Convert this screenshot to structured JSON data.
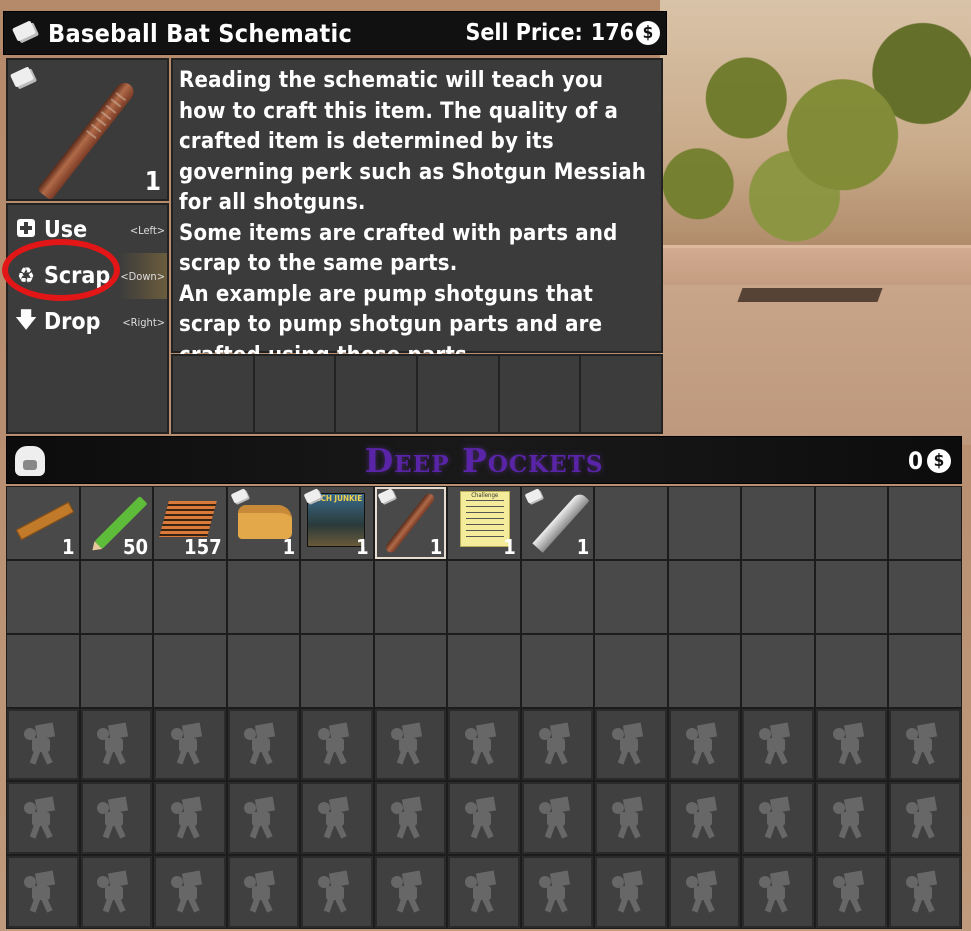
{
  "item": {
    "title": "Baseball Bat Schematic",
    "sell_label": "Sell Price:",
    "sell_value": "176",
    "coin_symbol": "$",
    "count": "1",
    "description_lines": [
      "Reading the schematic will teach you how to craft this item. The quality of a crafted item is determined by its governing perk such as Shotgun Messiah for all shotguns.",
      "Some items are crafted with parts and scrap to the same parts.",
      "An example are pump shotguns that scrap to pump shotgun parts and are crafted using those parts."
    ]
  },
  "actions": [
    {
      "label": "Use",
      "key": "<Left>",
      "icon": "medkit-icon"
    },
    {
      "label": "Scrap",
      "key": "<Down>",
      "icon": "recycle-icon"
    },
    {
      "label": "Drop",
      "key": "<Right>",
      "icon": "arrow-down-icon"
    }
  ],
  "backpack": {
    "title": "Deep Pockets",
    "money": "0",
    "coin_symbol": "$",
    "items": [
      {
        "name": "ruler",
        "count": "1",
        "schematic": false
      },
      {
        "name": "pencil",
        "count": "50",
        "schematic": false
      },
      {
        "name": "paper",
        "count": "157",
        "schematic": false
      },
      {
        "name": "cornbread",
        "count": "1",
        "schematic": true
      },
      {
        "name": "tech-junkie-magazine",
        "count": "1",
        "schematic": true
      },
      {
        "name": "baseball-bat-schematic",
        "count": "1",
        "schematic": true
      },
      {
        "name": "challenge-note",
        "count": "1",
        "schematic": false
      },
      {
        "name": "knife-schematic",
        "count": "1",
        "schematic": true
      }
    ],
    "magazine_cover_text": "TECH JUNKIE",
    "note_title": "Challenge"
  },
  "colors": {
    "highlight_ring": "#e21616",
    "backpack_title": "#5a24a8",
    "panel": "#3b3b3b"
  }
}
